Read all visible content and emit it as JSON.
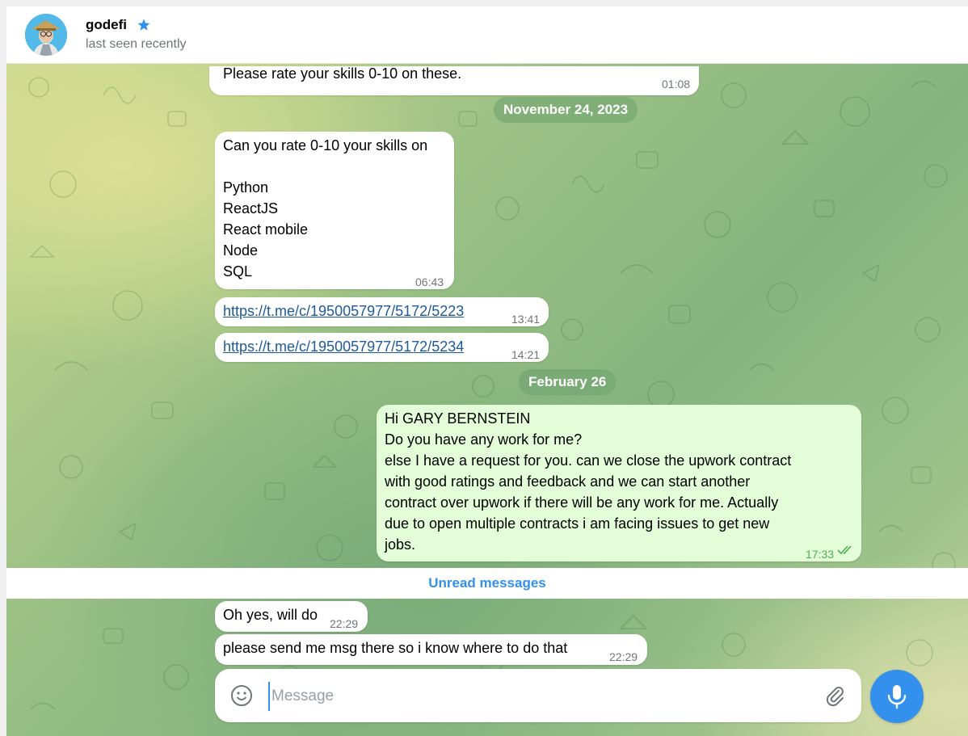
{
  "header": {
    "name": "godefi",
    "status": "last seen recently",
    "badge_icon": "star-icon"
  },
  "messages": {
    "m0": {
      "text": "Please rate your skills 0-10 on these.",
      "time": "01:08"
    },
    "date1": "November 24, 2023",
    "m1": {
      "text": "Can you rate 0-10 your skills on\n\nPython\nReactJS\nReact mobile\nNode\nSQL",
      "time": "06:43"
    },
    "m2": {
      "text": "https://t.me/c/1950057977/5172/5223",
      "time": "13:41"
    },
    "m3": {
      "text": "https://t.me/c/1950057977/5172/5234",
      "time": "14:21"
    },
    "date2": "February 26",
    "m4": {
      "text": "Hi GARY BERNSTEIN\nDo you have any work for me?\nelse I have a request for you. can we close the upwork contract\nwith good ratings and feedback and we can start another\ncontract over upwork if there will be any work for me. Actually\ndue to open multiple contracts i am facing issues to get new\njobs.",
      "time": "17:33",
      "status_icon": "double-check-icon"
    },
    "unread_label": "Unread messages",
    "m5": {
      "text": "Oh yes, will do",
      "time": "22:29"
    },
    "m6": {
      "text": "please send me msg there so i know where to do that",
      "time": "22:29"
    }
  },
  "composer": {
    "placeholder": "Message",
    "emoji_icon": "smile-icon",
    "attach_icon": "paperclip-icon",
    "send_icon": "microphone-icon"
  },
  "colors": {
    "accent": "#3390ec",
    "outgoing_bubble": "#e3fdd8",
    "incoming_bubble": "#ffffff",
    "outgoing_time": "#4fae4e"
  }
}
